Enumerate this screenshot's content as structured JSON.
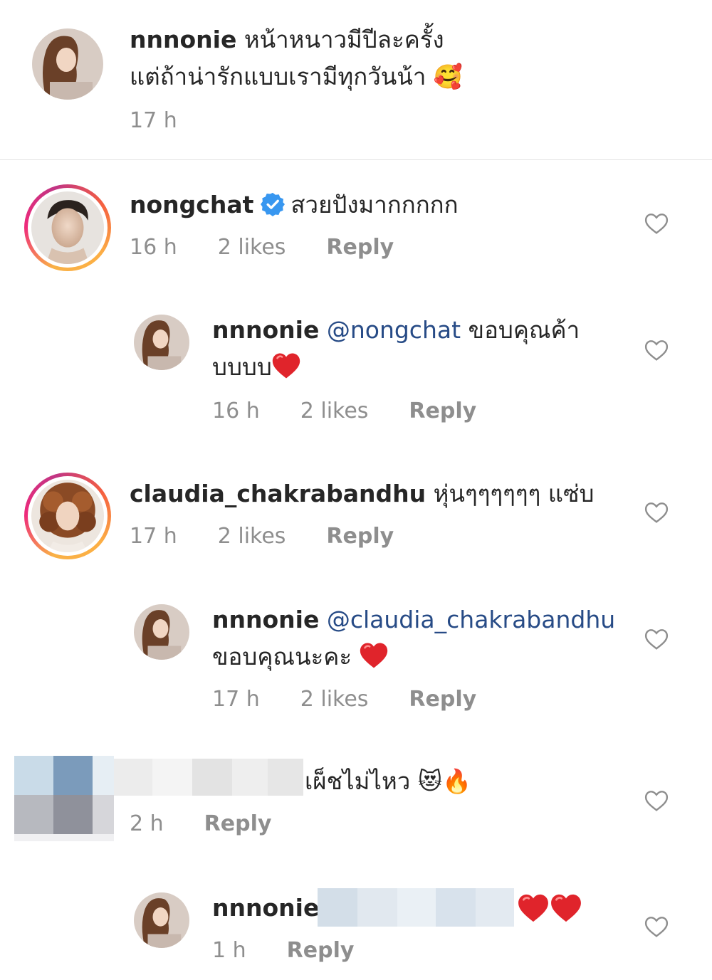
{
  "comments": [
    {
      "username": "nnnonie",
      "text_line1": "หน้าหนาวมีปีละครั้ง",
      "text_line2": "แต่ถ้าน่ารักแบบเรามีทุกวันน้า",
      "emoji": "🥰",
      "time": "17 h"
    },
    {
      "username": "nongchat",
      "text": "สวยปังมากกกกก",
      "time": "16 h",
      "likes": "2 likes",
      "reply_label": "Reply",
      "reply": {
        "username": "nnnonie",
        "mention": "@nongchat",
        "text_line1": "ขอบคุณค้า",
        "text_line2": "บบบบ",
        "time": "16 h",
        "likes": "2 likes",
        "reply_label": "Reply"
      }
    },
    {
      "username": "claudia_chakrabandhu",
      "text": "หุ่นๆๆๆๆๆๆ แซ่บ",
      "time": "17 h",
      "likes": "2 likes",
      "reply_label": "Reply",
      "reply": {
        "username": "nnnonie",
        "mention": "@claudia_chakrabandhu",
        "text_line2": "ขอบคุณนะคะ",
        "time": "17 h",
        "likes": "2 likes",
        "reply_label": "Reply"
      }
    },
    {
      "text": "เผ็ชไม่ไหว",
      "emoji": "😻🔥",
      "time": "2 h",
      "reply_label": "Reply",
      "reply": {
        "username": "nnnonie",
        "time": "1 h",
        "reply_label": "Reply"
      }
    }
  ],
  "icons": {
    "like": "heart-outline-icon",
    "verified": "verified-badge-icon",
    "red_heart": "red-heart-emoji"
  },
  "colors": {
    "text": "#262626",
    "meta": "#8e8e8e",
    "mention": "#274b86",
    "verified": "#3897f0",
    "heart_red": "#e0242b"
  }
}
